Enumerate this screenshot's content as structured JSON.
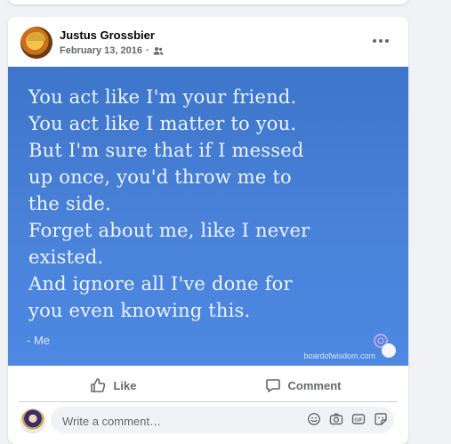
{
  "post": {
    "author": "Justus Grossbier",
    "date": "February 13, 2016",
    "separator": "·",
    "audience_icon": "friends-icon",
    "more_icon": "more-horizontal-icon",
    "image": {
      "quote": "You act like I'm your friend.\nYou act like I matter to you.\nBut I'm sure that if I messed\nup once, you'd throw me to\nthe side.\nForget about me, like I never\nexisted.\nAnd ignore all I've done for\nyou even knowing this.",
      "attribution": "- Me",
      "watermark": "boardofwisdom.com",
      "background_color": "#4a82d9"
    }
  },
  "actions": {
    "like_label": "Like",
    "like_icon": "thumbs-up-icon",
    "comment_label": "Comment",
    "comment_icon": "comment-icon"
  },
  "composer": {
    "placeholder": "Write a comment…",
    "icons": [
      "emoji-icon",
      "camera-icon",
      "gif-icon",
      "sticker-icon"
    ]
  }
}
